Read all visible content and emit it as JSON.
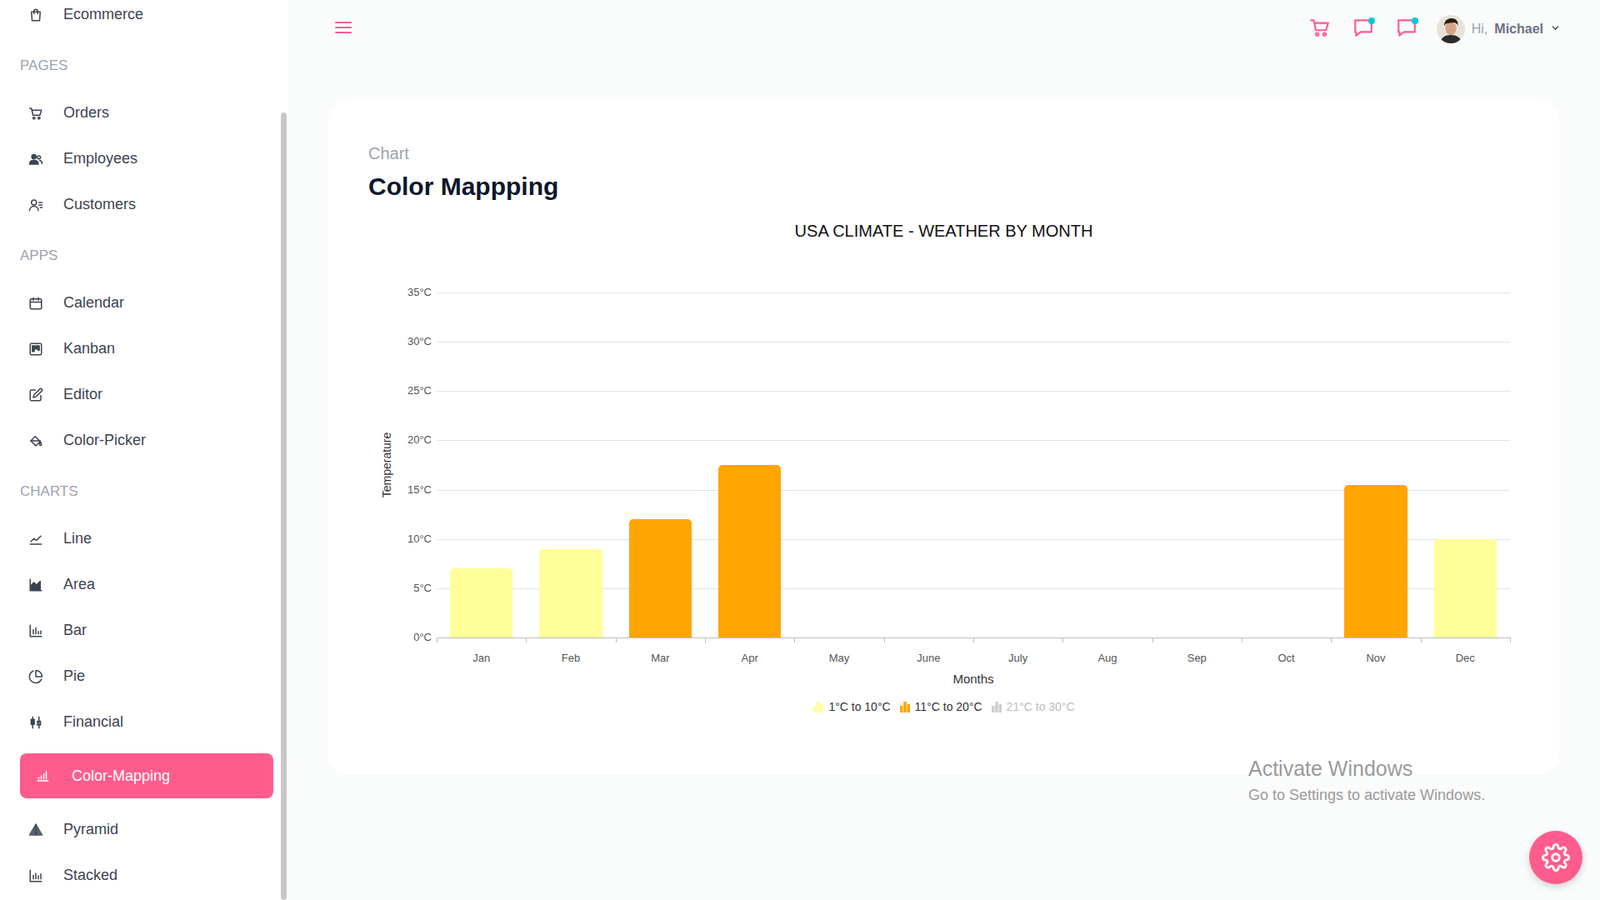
{
  "sidebar": {
    "sections": [
      {
        "items": [
          {
            "label": "Ecommerce",
            "selected": false
          }
        ]
      },
      {
        "title": "PAGES",
        "items": [
          {
            "label": "Orders",
            "selected": false
          },
          {
            "label": "Employees",
            "selected": false
          },
          {
            "label": "Customers",
            "selected": false
          }
        ]
      },
      {
        "title": "APPS",
        "items": [
          {
            "label": "Calendar",
            "selected": false
          },
          {
            "label": "Kanban",
            "selected": false
          },
          {
            "label": "Editor",
            "selected": false
          },
          {
            "label": "Color-Picker",
            "selected": false
          }
        ]
      },
      {
        "title": "CHARTS",
        "items": [
          {
            "label": "Line",
            "selected": false
          },
          {
            "label": "Area",
            "selected": false
          },
          {
            "label": "Bar",
            "selected": false
          },
          {
            "label": "Pie",
            "selected": false
          },
          {
            "label": "Financial",
            "selected": false
          },
          {
            "label": "Color-Mapping",
            "selected": true
          },
          {
            "label": "Pyramid",
            "selected": false
          },
          {
            "label": "Stacked",
            "selected": false
          }
        ]
      }
    ]
  },
  "navbar": {
    "icons": [
      {
        "kind": "cart",
        "badge": false
      },
      {
        "kind": "chat",
        "badge": true
      },
      {
        "kind": "notification",
        "badge": true
      }
    ],
    "user": {
      "greeting": "Hi,",
      "name": "Michael"
    }
  },
  "page": {
    "category": "Chart",
    "title": "Color Mappping"
  },
  "chart": {
    "title": "USA CLIMATE - WEATHER BY MONTH",
    "y_axis": {
      "title": "Temperature",
      "min": 0,
      "max": 35,
      "ticks": [
        "0°C",
        "5°C",
        "10°C",
        "15°C",
        "20°C",
        "25°C",
        "30°C",
        "35°C"
      ]
    },
    "x_axis": {
      "title": "Months",
      "categories": [
        "Jan",
        "Feb",
        "Mar",
        "Apr",
        "May",
        "June",
        "July",
        "Aug",
        "Sep",
        "Oct",
        "Nov",
        "Dec"
      ]
    },
    "series": [
      {
        "name": "USA CLIMATE",
        "values": [
          7,
          9,
          12,
          17.5,
          null,
          null,
          null,
          null,
          null,
          null,
          15.5,
          10
        ]
      }
    ],
    "legend": [
      {
        "label": "1°C to 10°C",
        "from": 1,
        "to": 10,
        "color": "#ffff99",
        "visible": true
      },
      {
        "label": "11°C to 20°C",
        "from": 11,
        "to": 20,
        "color": "#ffa500",
        "visible": true
      },
      {
        "label": "21°C to 30°C",
        "from": 21,
        "to": 30,
        "color": "#ff4040",
        "visible": false
      }
    ]
  },
  "watermark": {
    "title": "Activate Windows",
    "subtitle": "Go to Settings to activate Windows."
  }
}
